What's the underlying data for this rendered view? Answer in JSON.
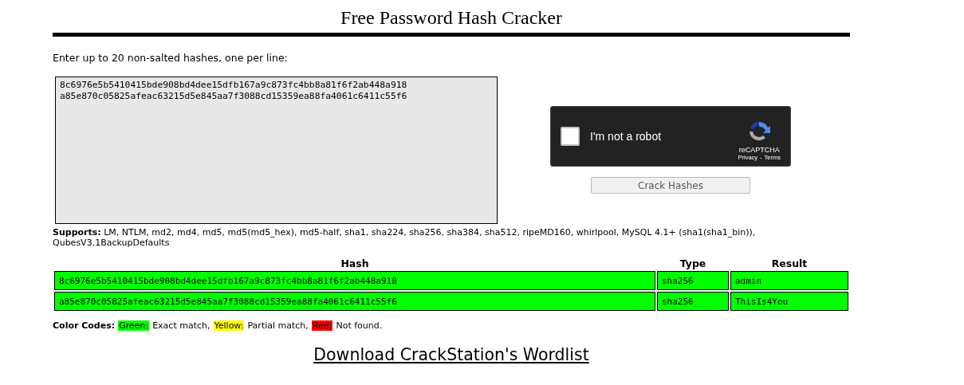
{
  "title": "Free Password Hash Cracker",
  "instructions": "Enter up to 20 non-salted hashes, one per line:",
  "hash_input": {
    "value": "8c6976e5b5410415bde908bd4dee15dfb167a9c873fc4bb8a81f6f2ab448a918\na85e870c05825afeac63215d5e845aa7f3088cd15359ea88fa4061c6411c55f6"
  },
  "captcha": {
    "label": "I'm not a robot",
    "checked": false,
    "brand": "reCAPTCHA",
    "privacy": "Privacy",
    "separator": "-",
    "terms": "Terms"
  },
  "submit_button": "Crack Hashes",
  "supports": "**Supports:** LM, NTLM, md2, md4, md5, md5(md5_hex), md5-half, sha1, sha224, sha256, sha384, sha512, ripeMD160, whirlpool, MySQL 4.1+ (sha1(sha1_bin)), QubesV3.1BackupDefaults",
  "table": {
    "columns": [
      "Hash",
      "Type",
      "Result"
    ],
    "rows": [
      {
        "hash": "8c6976e5b5410415bde908bd4dee15dfb167a9c873fc4bb8a81f6f2ab448a918",
        "type": "sha256",
        "result": "admin",
        "color": "#00ff00"
      },
      {
        "hash": "a85e870c05825afeac63215d5e845aa7f3088cd15359ea88fa4061c6411c55f6",
        "type": "sha256",
        "result": "ThisIs4You",
        "color": "#00ff00"
      }
    ]
  },
  "color_codes": {
    "label": "Color Codes:",
    "items": [
      {
        "name": "Green:",
        "description": "Exact match,",
        "color": "#00ff00"
      },
      {
        "name": "Yellow:",
        "description": "Partial match,",
        "color": "#ffff00"
      },
      {
        "name": "Red:",
        "description": "Not found.",
        "color": "#ff0000"
      }
    ]
  },
  "download_link": "Download CrackStation's Wordlist"
}
